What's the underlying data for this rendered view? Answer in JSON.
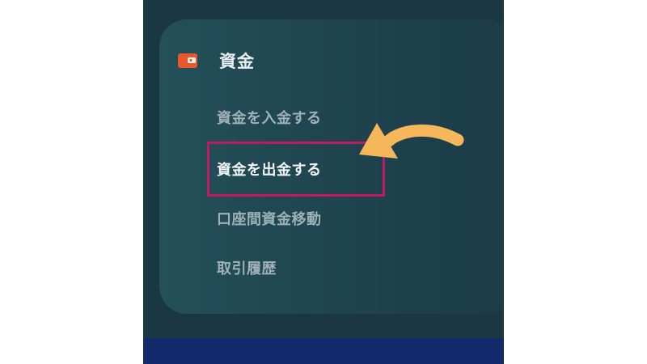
{
  "menu": {
    "icon": "wallet-icon",
    "title": "資金",
    "items": [
      {
        "label": "資金を入金する",
        "state": "normal"
      },
      {
        "label": "資金を出金する",
        "state": "active"
      },
      {
        "label": "口座間資金移動",
        "state": "normal"
      },
      {
        "label": "取引履歴",
        "state": "normal"
      }
    ]
  },
  "colors": {
    "panel_bg": "#1b3744",
    "card_bg": "#24505a",
    "bottom_bar": "#152a6c",
    "highlight_border": "#c2195f",
    "arrow": "#f6b75a",
    "wallet_icon": "#e8582c"
  }
}
